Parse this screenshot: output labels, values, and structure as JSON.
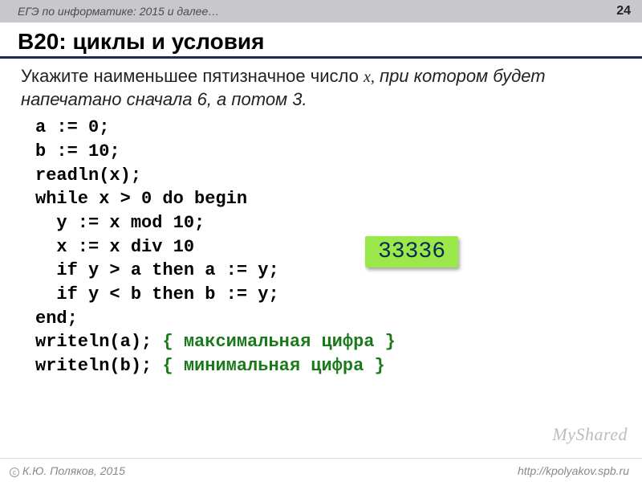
{
  "header": {
    "course": "ЕГЭ по информатике: 2015 и далее…",
    "page": "24"
  },
  "title": "B20: циклы и условия",
  "problem": {
    "lead": "Укажите наименьшее пятизначное число ",
    "var": "x,",
    "tail": " при котором будет напечатано сначала 6, а потом 3."
  },
  "code": {
    "l1": "a := 0;",
    "l2": "b := 10;",
    "l3": "readln(x);",
    "l4": "while x > 0 do begin",
    "l5": "  y := x mod 10;",
    "l6": "  x := x div 10",
    "l7": "  if y > a then a := y;",
    "l8": "  if y < b then b := y;",
    "l9": "end;",
    "l10a": "writeln(a); ",
    "l10c": "{ максимальная цифра }",
    "l11a": "writeln(b); ",
    "l11c": "{ минимальная цифра }"
  },
  "answer": "33336",
  "watermark": "MyShared",
  "footer": {
    "author": "К.Ю. Поляков, 2015",
    "url": "http://kpolyakov.spb.ru"
  }
}
